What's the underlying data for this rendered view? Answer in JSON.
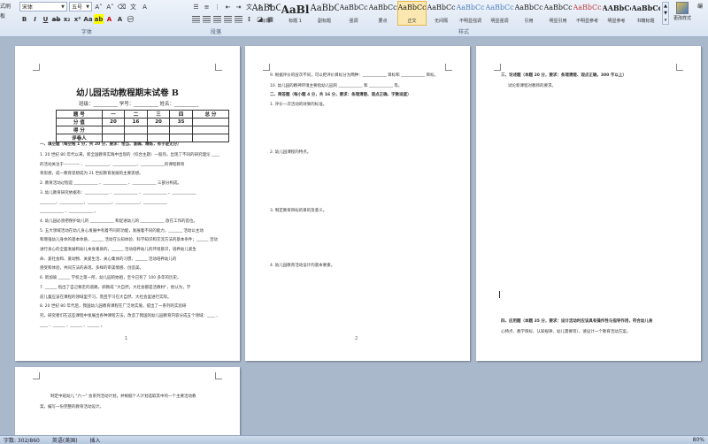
{
  "ribbon": {
    "left_stub": [
      "式刷",
      "板",
      "板(板)"
    ],
    "font_name": "宋体",
    "font_size": "五号",
    "group_font": "字体",
    "group_paragraph": "段落",
    "group_styles": "样式",
    "styles": [
      {
        "preview": "AaBbC",
        "name": "标题"
      },
      {
        "preview": "AaBl",
        "name": "标题 1"
      },
      {
        "preview": "AaBbC",
        "name": "副标题"
      },
      {
        "preview": "AaBbCcDd",
        "name": "强调"
      },
      {
        "preview": "AaBbCcD",
        "name": "要点"
      },
      {
        "preview": "AaBbCcDc",
        "name": "正文"
      },
      {
        "preview": "AaBbCcDc",
        "name": "无间隔"
      },
      {
        "preview": "AaBbCcDc",
        "name": "不明显强调"
      },
      {
        "preview": "AaBbCcDc",
        "name": "明显强调"
      },
      {
        "preview": "AaBbCcDc",
        "name": "引用"
      },
      {
        "preview": "AaBbCcDc",
        "name": "明显引用"
      },
      {
        "preview": "AaBbCcDc",
        "name": "不明显参考"
      },
      {
        "preview": "AABbCcI",
        "name": "明显参考"
      },
      {
        "preview": "AaBbCcI",
        "name": "书籍标题"
      }
    ],
    "change_styles": "更改样式",
    "right_stub": "编"
  },
  "page1": {
    "title": "幼儿园活动教程期末试卷 B",
    "info": "班级：__________ 学号：__________ 姓名：__________",
    "table": {
      "header": [
        "题 号",
        "一",
        "二",
        "三",
        "四",
        "总 分"
      ],
      "row_score": [
        "分 值",
        "20",
        "16",
        "20",
        "35",
        ""
      ],
      "row_get": [
        "得 分",
        "",
        "",
        "",
        "",
        ""
      ],
      "row_grader": [
        "评卷人",
        "",
        "",
        "",
        "",
        ""
      ]
    },
    "section1": "一、填空题（每空格 1 分，共 20 分，要求：恰当、准确、精炼，有字迹无分）",
    "lines": [
      "1. 20 世纪 80 年代以来，新全国教育实践中出现的（综合主题）一股热，出现了不同的研究理论 ____",
      "的活动关注于———— 、____________、____________、____________的课程教育",
      "育思想，成一教育思想成为 21 世纪教育发展的主要思想。",
      "2. 教育活动过程是 ____________ 、____________ 、____________ 三部分构成。",
      "3. 幼儿教育研究依据有：____________ 、____________ 、____________ 、____________",
      "________、____________、____________、____________、____________",
      "____________ 、____________ 。",
      "4. 幼儿园必须把保护幼儿的 ____________ 和促进幼儿的 ____________ 放在工作的首位。",
      "5. 五大领域活动在幼儿身心发展中有着不同的功能，发展着不同的能力。_______ 活动以主动",
      "和增强幼儿身体的基本体质，______ 活动在认知体验、科学知识和交流方法的基本条件；______ 活动",
      "进行身心的全面发展和幼儿本身素质的，______ 活动培养幼儿的环境意识，培养幼儿爱生",
      "命、爱社会和、爱动物、关爱生活、关心集体的习惯、______ 活动培养幼儿的",
      "感受和体验，共同方法的表现、多样的审美情感、创造美。",
      "6. 新加坡 ______ 学校之第一所，幼儿园的始祖，至今已有了 100 多年的历史。",
      "7. ______ 指出了自己要走的道路，即教成 \"大自然，大社会都是活教材\"，他认为，学",
      "前儿童应该在课程的领域里学习，而且学习在大自然、大社会里进行实际。",
      "8. 20 世纪 80 年代后，我国幼儿园教育课程在广泛地实施，提出了一系列的实验研",
      "究，研究者们在这些课程中发展出各种课程方法，改造了我国的幼儿园教育内容分成五个领域：____ 、",
      "____ 、______ 、______ 、______ 。"
    ],
    "page_number": "1"
  },
  "page2": {
    "lines": [
      "9. 根据评价的层次不同，可以把评价目标分为两种：____________ 目标和 ____________ 目标。",
      "10. 幼儿园的精神环境主要指幼儿园的 ____________ 和 ____________ 等。",
      "二、简答题（每小题 4 分，共 16 分，要求：条理清楚、观点正确、字数适度）"
    ],
    "questions": [
      "1. 评价一次活动的效果的标准。",
      "2. 幼儿园课程的特点。",
      "3. 制定教育目标的目的及意义。",
      "4. 幼儿园教育活动设计的基本要素。"
    ],
    "page_number": "2"
  },
  "page3": {
    "lines": [
      "三、论述题（本题 20 分，要求：条理清楚、观点正确，300 字以上）",
      "试论新课程对教师的要求。"
    ],
    "section4": [
      "四、应用题（本题 35 分，要求：设计活动时应该具有操作性与指导作用，符合幼儿身",
      "心特点、教学目标、认知规律、幼儿需要等），请设计一个教育活动方案。"
    ]
  },
  "page4": {
    "lines": [
      "制定中班幼儿 \"六一\" 会系列活动计划，并根据个人计划选取其中的一个主要活动教",
      "案，编写一份完整的教育活动设计。"
    ]
  },
  "status": {
    "words": "字数: 302/860",
    "lang": "英语(美国)",
    "mode": "插入",
    "zoom": "80%"
  }
}
